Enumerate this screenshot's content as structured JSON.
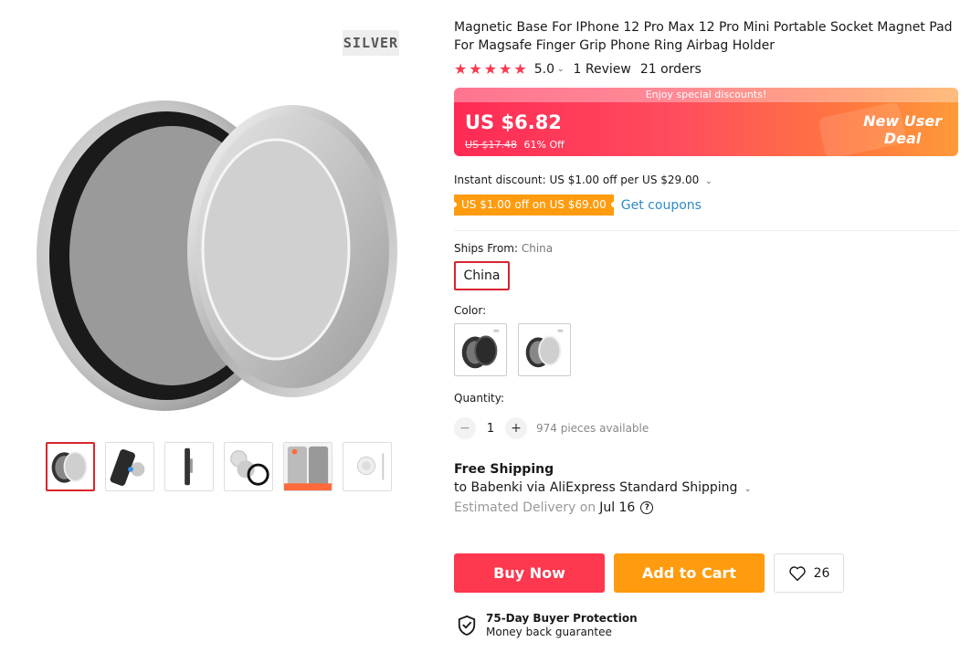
{
  "product": {
    "title": "Magnetic Base For IPhone 12 Pro Max 12 Pro Mini Portable Socket Magnet Pad For Magsafe Finger Grip Phone Ring Airbag Holder",
    "image_tag": "SILVER",
    "rating": "5.0",
    "rating_chevron": "⌄",
    "reviews": "1 Review",
    "orders": "21 orders"
  },
  "price": {
    "banner": "Enjoy special discounts!",
    "current": "US $6.82",
    "original": "US $17.48",
    "discount": "61% Off",
    "new_user_line1": "New User",
    "new_user_line2": "Deal"
  },
  "discounts": {
    "instant": "Instant discount: US $1.00 off per US $29.00",
    "coupon": "US $1.00 off on US $69.00",
    "get_coupons": "Get coupons"
  },
  "shipping_from": {
    "label": "Ships From:",
    "value": "China",
    "option": "China"
  },
  "color": {
    "label": "Color:"
  },
  "quantity": {
    "label": "Quantity:",
    "minus": "−",
    "value": "1",
    "plus": "+",
    "available": "974 pieces available"
  },
  "delivery": {
    "free_shipping": "Free Shipping",
    "via": "to Babenki via AliExpress Standard Shipping",
    "estimated_label": "Estimated Delivery on",
    "date": "Jul 16",
    "help": "?"
  },
  "actions": {
    "buy_now": "Buy Now",
    "add_to_cart": "Add to Cart",
    "wishlist_count": "26"
  },
  "protection": {
    "title": "75-Day Buyer Protection",
    "subtitle": "Money back guarantee"
  },
  "colors": {
    "accent_red": "#fd384f",
    "accent_orange": "#ff9b0e",
    "link_blue": "#2c8bc5",
    "star_red": "#fd384f"
  },
  "icons": {
    "stars": "star-icon",
    "wishlist": "heart-icon",
    "protection": "shield-check-icon",
    "help": "question-icon"
  }
}
